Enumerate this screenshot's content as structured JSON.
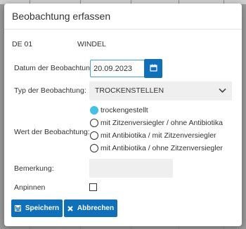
{
  "dialog": {
    "title": "Beobachtung erfassen"
  },
  "info": {
    "location": "DE 01",
    "item": "WINDEL"
  },
  "form": {
    "date_label": "Datum der Beobachtung:",
    "date_value": "20.09.2023",
    "type_label": "Typ der Beobachtung:",
    "type_value": "TROCKENSTELLEN",
    "value_label": "Wert der Beobachtung:",
    "options": [
      {
        "label": "trockengestellt",
        "selected": true
      },
      {
        "label": "mit Zitzenversiegler / ohne Antibiotika",
        "selected": false
      },
      {
        "label": "mit Antibiotika / mit Zitzenversiegler",
        "selected": false
      },
      {
        "label": "mit Antibiotika / ohne Zitzenversiegler",
        "selected": false
      }
    ],
    "remark_label": "Bemerkung:",
    "remark_value": "",
    "pin_label": "Anpinnen",
    "pin_checked": false
  },
  "buttons": {
    "save_label": "Speichern",
    "cancel_label": "Abbrechen"
  },
  "icons": {
    "date": "calendar-icon",
    "select": "chevron-down-icon",
    "save": "floppy-disk-icon",
    "cancel": "close-icon"
  },
  "colors": {
    "primary": "#0e6fba",
    "radio_selected": "#3fc1e8",
    "input_focus": "#3aa7e0",
    "field_bg": "#efefef"
  }
}
